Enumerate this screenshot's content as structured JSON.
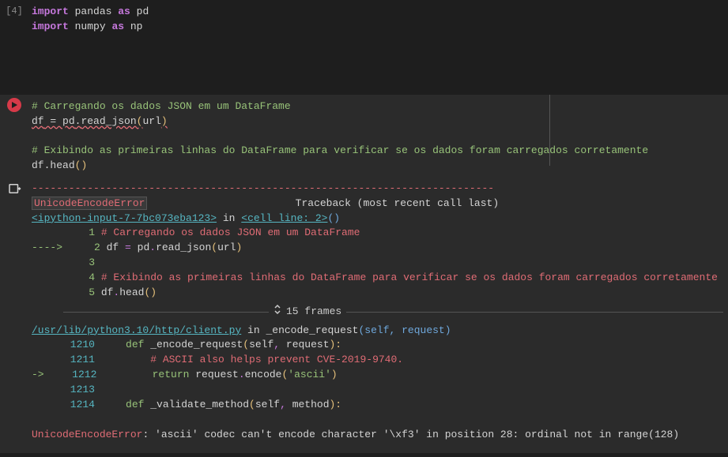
{
  "cell1": {
    "exec_count": "[4]",
    "line1": {
      "kw_import": "import",
      "mod": "pandas",
      "kw_as": "as",
      "alias": "pd"
    },
    "line2": {
      "kw_import": "import",
      "mod": "numpy",
      "kw_as": "as",
      "alias": "np"
    }
  },
  "cell2": {
    "line1_comment": "# Carregando os dados JSON em um DataFrame",
    "line2": {
      "a": "df",
      "eq": " = ",
      "b": "pd",
      "dot": ".",
      "c": "read_json",
      "lp": "(",
      "arg": "url",
      "rp": ")"
    },
    "line3_comment": "# Exibindo as primeiras linhas do DataFrame para verificar se os dados foram carregados corretamente",
    "line4": {
      "a": "df",
      "dot": ".",
      "b": "head",
      "lp": "(",
      "rp": ")"
    }
  },
  "output": {
    "dash": "---------------------------------------------------------------------------",
    "err_name": "UnicodeEncodeError",
    "tb_label": "Traceback (most recent call last)",
    "frame1": {
      "link": "<ipython-input-7-7bc073eba123>",
      "in": " in ",
      "link2": "<cell line: 2>",
      "tail": "()",
      "l1": {
        "n": "1",
        "txt": "# Carregando os dados JSON em um DataFrame"
      },
      "l2": {
        "arrow": "----> ",
        "n": "2",
        "a": "df ",
        "eq": "=",
        "b": " pd",
        "dot": ".",
        "c": "read_json",
        "lp": "(",
        "arg": "url",
        "rp": ")"
      },
      "l3": {
        "n": "3",
        "txt": ""
      },
      "l4": {
        "n": "4",
        "txt": "# Exibindo as primeiras linhas do DataFrame para verificar se os dados foram carregados corretamente"
      },
      "l5": {
        "n": "5",
        "a": "df",
        "dot": ".",
        "b": "head",
        "lp": "(",
        "rp": ")"
      }
    },
    "frames_toggle": "15 frames",
    "frame2": {
      "link": "/usr/lib/python3.10/http/client.py",
      "in": " in ",
      "func": "_encode_request",
      "args": "(self, request)",
      "l1": {
        "n": "1210",
        "kw": "def",
        "nm": " _encode_request",
        "lp": "(",
        "args": "self",
        "c": ", ",
        "a2": "request",
        "rp": "):"
      },
      "l2": {
        "n": "1211",
        "txt": "# ASCII also helps prevent CVE-2019-9740."
      },
      "l3": {
        "arrow": "-> ",
        "n": "1212",
        "kw": "return",
        "a": " request",
        "dot": ".",
        "b": "encode",
        "lp": "(",
        "s": "'ascii'",
        "rp": ")"
      },
      "l4": {
        "n": "1213",
        "txt": ""
      },
      "l5": {
        "n": "1214",
        "kw": "def",
        "nm": " _validate_method",
        "lp": "(",
        "args": "self",
        "c": ", ",
        "a2": "method",
        "rp": "):"
      }
    },
    "final": {
      "name": "UnicodeEncodeError",
      "sep": ": ",
      "msg": "'ascii' codec can't encode character '\\xf3' in position 28: ordinal not in range(128)"
    }
  }
}
